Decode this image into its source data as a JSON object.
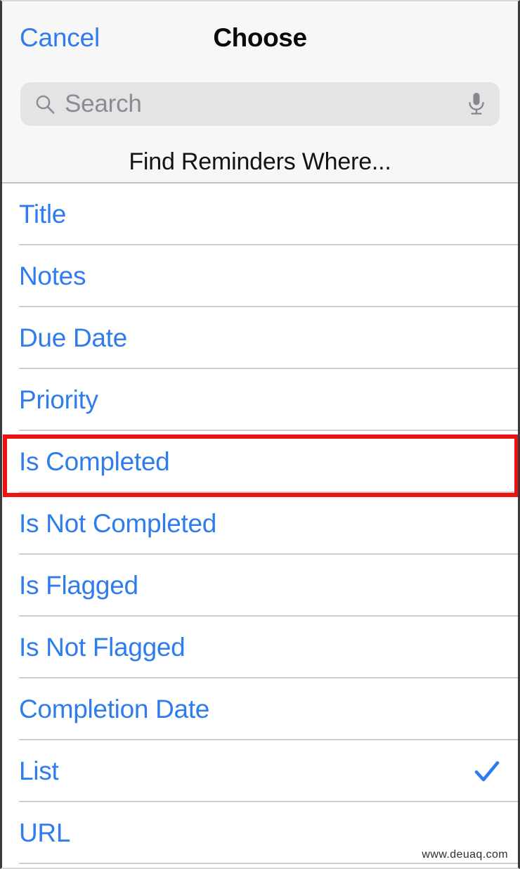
{
  "window": {
    "title": "Choose"
  },
  "navbar": {
    "cancel_label": "Cancel",
    "title": "Choose"
  },
  "search": {
    "placeholder": "Search",
    "value": "",
    "search_icon": "search-icon",
    "mic_icon": "microphone-icon"
  },
  "section": {
    "caption": "Find Reminders Where..."
  },
  "list": {
    "items": [
      {
        "label": "Title",
        "checked": false,
        "highlighted": false
      },
      {
        "label": "Notes",
        "checked": false,
        "highlighted": false
      },
      {
        "label": "Due Date",
        "checked": false,
        "highlighted": false
      },
      {
        "label": "Priority",
        "checked": false,
        "highlighted": false
      },
      {
        "label": "Is Completed",
        "checked": false,
        "highlighted": true
      },
      {
        "label": "Is Not Completed",
        "checked": false,
        "highlighted": false
      },
      {
        "label": "Is Flagged",
        "checked": false,
        "highlighted": false
      },
      {
        "label": "Is Not Flagged",
        "checked": false,
        "highlighted": false
      },
      {
        "label": "Completion Date",
        "checked": false,
        "highlighted": false
      },
      {
        "label": "List",
        "checked": true,
        "highlighted": false
      },
      {
        "label": "URL",
        "checked": false,
        "highlighted": false
      }
    ]
  },
  "annotation": {
    "highlight_color": "#ee1111",
    "highlight_target": "Is Completed"
  },
  "watermark": {
    "text": "www.deuaq.com"
  },
  "colors": {
    "accent_blue": "#2f7ced",
    "header_background": "#f7f7f7",
    "search_background": "#e4e4e6",
    "separator": "#cfcfcf",
    "title_text": "#0a0a0a",
    "placeholder_text": "#8b8b90"
  }
}
